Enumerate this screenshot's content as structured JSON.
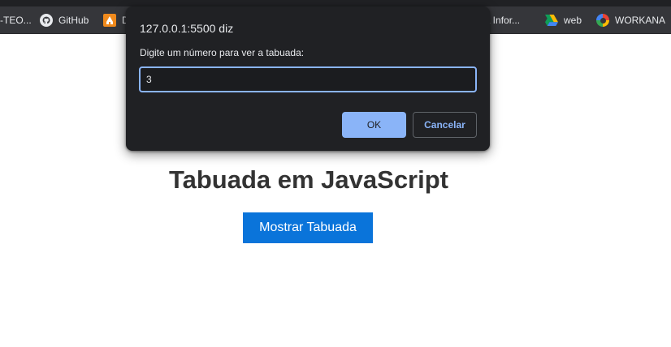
{
  "bookmarks": {
    "items": [
      {
        "label": "-TEO...",
        "icon": "folder-icon"
      },
      {
        "label": "GitHub",
        "icon": "github-icon"
      },
      {
        "label": "D",
        "icon": "bookmark-favicon-icon"
      },
      {
        "label": "da Infor...",
        "icon": "folder-icon"
      },
      {
        "label": "web",
        "icon": "google-drive-icon"
      },
      {
        "label": "WORKANA",
        "icon": "workana-icon"
      }
    ]
  },
  "page": {
    "title": "Tabuada em JavaScript",
    "button_label": "Mostrar Tabuada"
  },
  "dialog": {
    "origin": "127.0.0.1:5500 diz",
    "message": "Digite um número para ver a tabuada:",
    "input_value": "3",
    "ok_label": "OK",
    "cancel_label": "Cancelar"
  },
  "colors": {
    "accent": "#8ab4f8",
    "button_blue": "#0a74da",
    "dialog_bg": "#202124",
    "bookmarks_bg": "#35363a"
  }
}
